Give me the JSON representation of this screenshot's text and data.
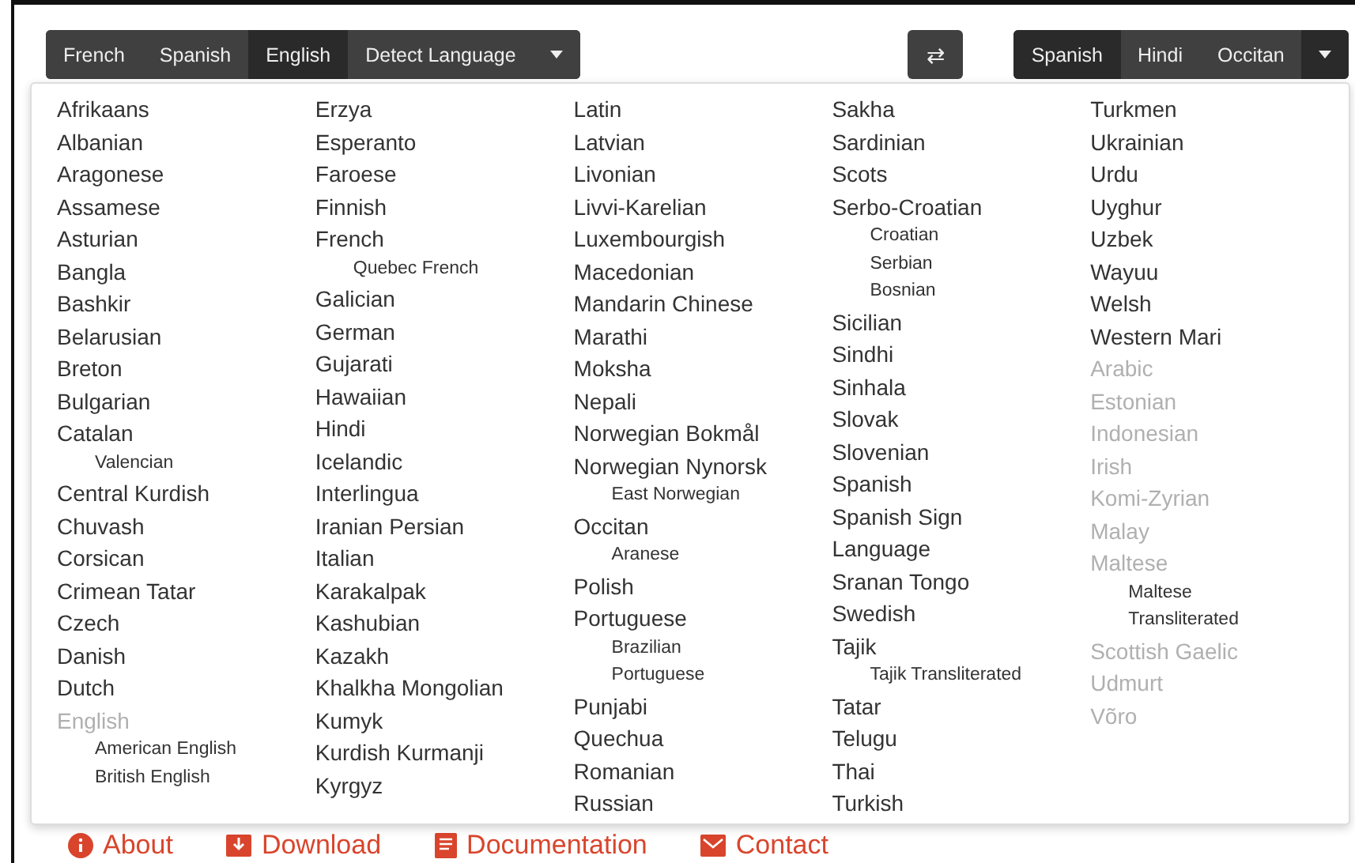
{
  "source_bar": {
    "languages": [
      {
        "label": "French",
        "selected": false
      },
      {
        "label": "Spanish",
        "selected": false
      },
      {
        "label": "English",
        "selected": true
      },
      {
        "label": "Detect Language",
        "selected": false
      }
    ]
  },
  "swap_button": {
    "label": "⇄"
  },
  "target_bar": {
    "languages": [
      {
        "label": "Spanish",
        "selected": true
      },
      {
        "label": "Hindi",
        "selected": false
      },
      {
        "label": "Occitan",
        "selected": false
      }
    ]
  },
  "dropdown": {
    "columns": [
      [
        {
          "name": "Afrikaans",
          "disabled": false
        },
        {
          "name": "Albanian",
          "disabled": false
        },
        {
          "name": "Aragonese",
          "disabled": false
        },
        {
          "name": "Assamese",
          "disabled": false
        },
        {
          "name": "Asturian",
          "disabled": false
        },
        {
          "name": "Bangla",
          "disabled": false
        },
        {
          "name": "Bashkir",
          "disabled": false
        },
        {
          "name": "Belarusian",
          "disabled": false
        },
        {
          "name": "Breton",
          "disabled": false
        },
        {
          "name": "Bulgarian",
          "disabled": false
        },
        {
          "name": "Catalan",
          "disabled": false,
          "children": [
            {
              "name": "Valencian"
            }
          ]
        },
        {
          "name": "Central Kurdish",
          "disabled": false
        },
        {
          "name": "Chuvash",
          "disabled": false
        },
        {
          "name": "Corsican",
          "disabled": false
        },
        {
          "name": "Crimean Tatar",
          "disabled": false
        },
        {
          "name": "Czech",
          "disabled": false
        },
        {
          "name": "Danish",
          "disabled": false
        },
        {
          "name": "Dutch",
          "disabled": false
        },
        {
          "name": "English",
          "disabled": true,
          "children": [
            {
              "name": "American English"
            },
            {
              "name": "British English"
            }
          ]
        }
      ],
      [
        {
          "name": "Erzya",
          "disabled": false
        },
        {
          "name": "Esperanto",
          "disabled": false
        },
        {
          "name": "Faroese",
          "disabled": false
        },
        {
          "name": "Finnish",
          "disabled": false
        },
        {
          "name": "French",
          "disabled": false,
          "children": [
            {
              "name": "Quebec French"
            }
          ]
        },
        {
          "name": "Galician",
          "disabled": false
        },
        {
          "name": "German",
          "disabled": false
        },
        {
          "name": "Gujarati",
          "disabled": false
        },
        {
          "name": "Hawaiian",
          "disabled": false
        },
        {
          "name": "Hindi",
          "disabled": false
        },
        {
          "name": "Icelandic",
          "disabled": false
        },
        {
          "name": "Interlingua",
          "disabled": false
        },
        {
          "name": "Iranian Persian",
          "disabled": false
        },
        {
          "name": "Italian",
          "disabled": false
        },
        {
          "name": "Karakalpak",
          "disabled": false
        },
        {
          "name": "Kashubian",
          "disabled": false
        },
        {
          "name": "Kazakh",
          "disabled": false
        },
        {
          "name": "Khalkha Mongolian",
          "disabled": false
        },
        {
          "name": "Kumyk",
          "disabled": false
        },
        {
          "name": "Kurdish Kurmanji",
          "disabled": false
        },
        {
          "name": "Kyrgyz",
          "disabled": false
        }
      ],
      [
        {
          "name": "Latin",
          "disabled": false
        },
        {
          "name": "Latvian",
          "disabled": false
        },
        {
          "name": "Livonian",
          "disabled": false
        },
        {
          "name": "Livvi-Karelian",
          "disabled": false
        },
        {
          "name": "Luxembourgish",
          "disabled": false
        },
        {
          "name": "Macedonian",
          "disabled": false
        },
        {
          "name": "Mandarin Chinese",
          "disabled": false
        },
        {
          "name": "Marathi",
          "disabled": false
        },
        {
          "name": "Moksha",
          "disabled": false
        },
        {
          "name": "Nepali",
          "disabled": false
        },
        {
          "name": "Norwegian Bokmål",
          "disabled": false
        },
        {
          "name": "Norwegian Nynorsk",
          "disabled": false,
          "children": [
            {
              "name": "East Norwegian"
            }
          ]
        },
        {
          "name": "Occitan",
          "disabled": false,
          "children": [
            {
              "name": "Aranese"
            }
          ]
        },
        {
          "name": "Polish",
          "disabled": false
        },
        {
          "name": "Portuguese",
          "disabled": false,
          "children": [
            {
              "name": "Brazilian Portuguese"
            }
          ]
        },
        {
          "name": "Punjabi",
          "disabled": false
        },
        {
          "name": "Quechua",
          "disabled": false
        },
        {
          "name": "Romanian",
          "disabled": false
        },
        {
          "name": "Russian",
          "disabled": false
        }
      ],
      [
        {
          "name": "Sakha",
          "disabled": false
        },
        {
          "name": "Sardinian",
          "disabled": false
        },
        {
          "name": "Scots",
          "disabled": false
        },
        {
          "name": "Serbo-Croatian",
          "disabled": false,
          "children": [
            {
              "name": "Croatian"
            },
            {
              "name": "Serbian"
            },
            {
              "name": "Bosnian"
            }
          ]
        },
        {
          "name": "Sicilian",
          "disabled": false
        },
        {
          "name": "Sindhi",
          "disabled": false
        },
        {
          "name": "Sinhala",
          "disabled": false
        },
        {
          "name": "Slovak",
          "disabled": false
        },
        {
          "name": "Slovenian",
          "disabled": false
        },
        {
          "name": "Spanish",
          "disabled": false
        },
        {
          "name": "Spanish Sign Language",
          "disabled": false
        },
        {
          "name": "Sranan Tongo",
          "disabled": false
        },
        {
          "name": "Swedish",
          "disabled": false
        },
        {
          "name": "Tajik",
          "disabled": false,
          "children": [
            {
              "name": "Tajik Transliterated"
            }
          ]
        },
        {
          "name": "Tatar",
          "disabled": false
        },
        {
          "name": "Telugu",
          "disabled": false
        },
        {
          "name": "Thai",
          "disabled": false
        },
        {
          "name": "Turkish",
          "disabled": false
        }
      ],
      [
        {
          "name": "Turkmen",
          "disabled": false
        },
        {
          "name": "Ukrainian",
          "disabled": false
        },
        {
          "name": "Urdu",
          "disabled": false
        },
        {
          "name": "Uyghur",
          "disabled": false
        },
        {
          "name": "Uzbek",
          "disabled": false
        },
        {
          "name": "Wayuu",
          "disabled": false
        },
        {
          "name": "Welsh",
          "disabled": false
        },
        {
          "name": "Western Mari",
          "disabled": false
        },
        {
          "name": "Arabic",
          "disabled": true
        },
        {
          "name": "Estonian",
          "disabled": true
        },
        {
          "name": "Indonesian",
          "disabled": true
        },
        {
          "name": "Irish",
          "disabled": true
        },
        {
          "name": "Komi-Zyrian",
          "disabled": true
        },
        {
          "name": "Malay",
          "disabled": true
        },
        {
          "name": "Maltese",
          "disabled": true,
          "children": [
            {
              "name": "Maltese Transliterated"
            }
          ]
        },
        {
          "name": "Scottish Gaelic",
          "disabled": true
        },
        {
          "name": "Udmurt",
          "disabled": true
        },
        {
          "name": "Võro",
          "disabled": true
        }
      ]
    ]
  },
  "footer_links": [
    {
      "kind": "info",
      "label": "About"
    },
    {
      "kind": "download",
      "label": "Download"
    },
    {
      "kind": "book",
      "label": "Documentation"
    },
    {
      "kind": "mail",
      "label": "Contact"
    }
  ]
}
